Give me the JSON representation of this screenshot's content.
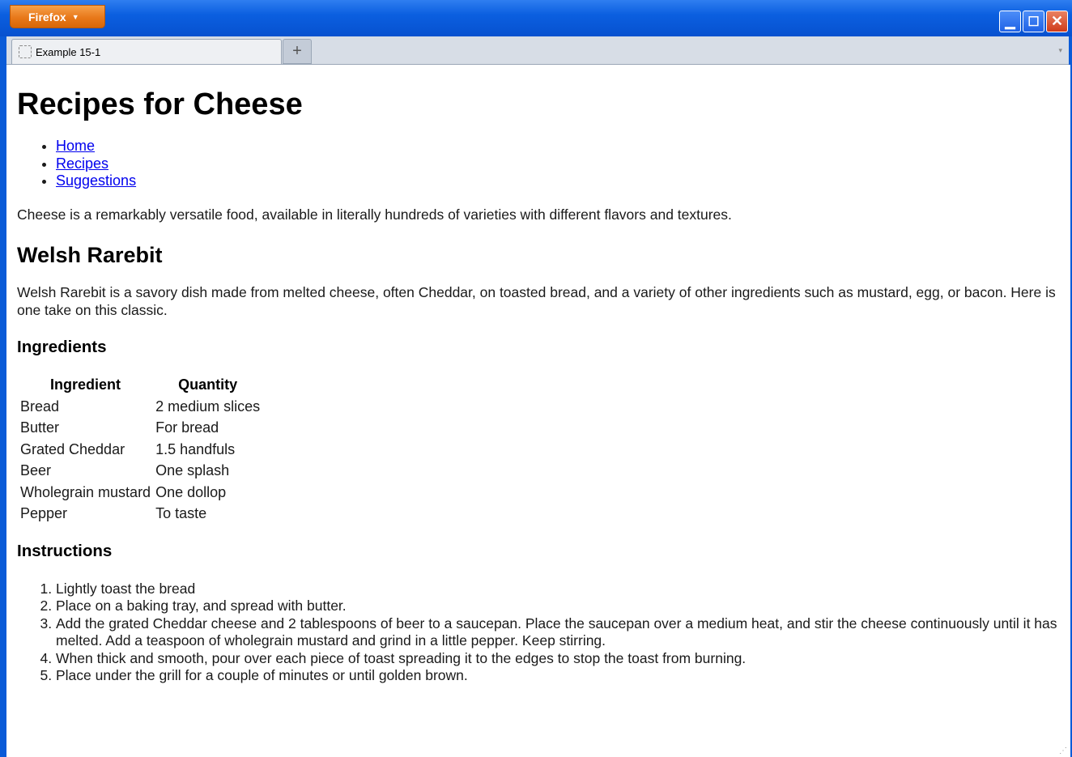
{
  "browser": {
    "menu_button_label": "Firefox",
    "tab_title": "Example 15-1",
    "new_tab_symbol": "+",
    "minimize_symbol": "▁",
    "maximize_symbol": "☐",
    "close_symbol": "✕",
    "tab_list_symbol": "▾"
  },
  "page": {
    "title": "Recipes for Cheese",
    "nav": [
      "Home",
      "Recipes",
      "Suggestions"
    ],
    "intro": "Cheese is a remarkably versatile food, available in literally hundreds of varieties with different flavors and textures.",
    "recipe_title": "Welsh Rarebit",
    "recipe_description": "Welsh Rarebit is a savory dish made from melted cheese, often Cheddar, on toasted bread, and a variety of other ingredients such as mustard, egg, or bacon. Here is one take on this classic.",
    "ingredients_heading": "Ingredients",
    "table": {
      "headers": [
        "Ingredient",
        "Quantity"
      ],
      "rows": [
        [
          "Bread",
          "2 medium slices"
        ],
        [
          "Butter",
          "For bread"
        ],
        [
          "Grated Cheddar",
          "1.5 handfuls"
        ],
        [
          "Beer",
          "One splash"
        ],
        [
          "Wholegrain mustard",
          "One dollop"
        ],
        [
          "Pepper",
          "To taste"
        ]
      ]
    },
    "instructions_heading": "Instructions",
    "instructions": [
      "Lightly toast the bread",
      "Place on a baking tray, and spread with butter.",
      "Add the grated Cheddar cheese and 2 tablespoons of beer to a saucepan. Place the saucepan over a medium heat, and stir the cheese continuously until it has melted. Add a teaspoon of wholegrain mustard and grind in a little pepper. Keep stirring.",
      "When thick and smooth, pour over each piece of toast spreading it to the edges to stop the toast from burning.",
      "Place under the grill for a couple of minutes or until golden brown."
    ]
  }
}
